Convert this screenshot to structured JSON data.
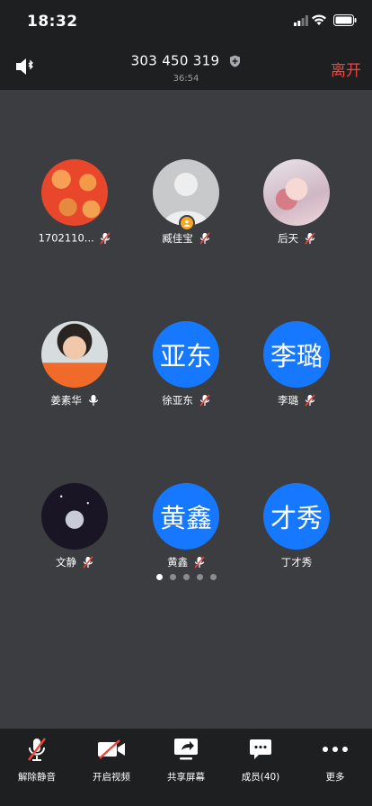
{
  "status_bar": {
    "time": "18:32"
  },
  "header": {
    "meeting_id": "303 450 319",
    "duration": "36:54",
    "leave_label": "离开"
  },
  "participants": [
    {
      "name": "1702110...",
      "avatar_text": "",
      "mic": "muted"
    },
    {
      "name": "臧佳宝",
      "avatar_text": "",
      "mic": "muted",
      "host": true
    },
    {
      "name": "后天",
      "avatar_text": "",
      "mic": "muted"
    },
    {
      "name": "姜素华",
      "avatar_text": "",
      "mic": "on"
    },
    {
      "name": "徐亚东",
      "avatar_text": "亚东",
      "mic": "muted"
    },
    {
      "name": "李璐",
      "avatar_text": "李璐",
      "mic": "muted"
    },
    {
      "name": "文静",
      "avatar_text": "",
      "mic": "muted"
    },
    {
      "name": "黄鑫",
      "avatar_text": "黄鑫",
      "mic": "muted"
    },
    {
      "name": "丁才秀",
      "avatar_text": "才秀",
      "mic": "none"
    }
  ],
  "pagination": {
    "pages": 5,
    "current": 1
  },
  "toolbar": {
    "unmute_label": "解除静音",
    "video_label": "开启视频",
    "share_label": "共享屏幕",
    "members_label": "成员(40)",
    "more_label": "更多"
  },
  "colors": {
    "accent_blue": "#1677ff",
    "leave_red": "#f0443c",
    "bar_bg": "#1e1f21",
    "main_bg": "#3b3d40"
  }
}
